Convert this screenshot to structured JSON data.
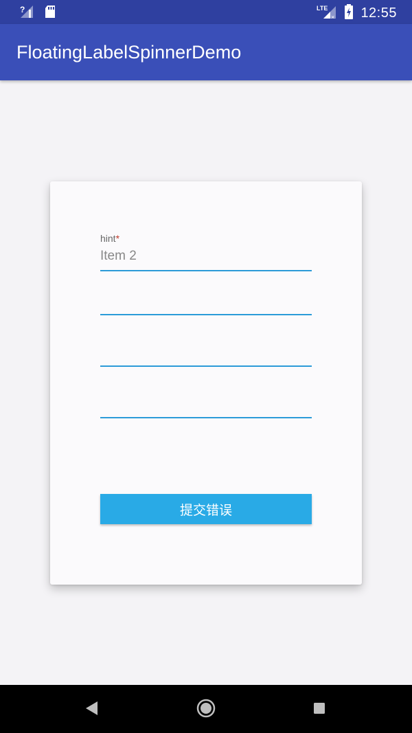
{
  "status_bar": {
    "time": "12:55",
    "icons": [
      "signal-unknown-icon",
      "sd-card-icon",
      "lte-signal-icon",
      "battery-charging-icon"
    ],
    "lte_label": "LTE",
    "background": "#2f40a0"
  },
  "app_bar": {
    "title": "FloatingLabelSpinnerDemo",
    "background": "#3a4fb8"
  },
  "form": {
    "spinner1": {
      "hint": "hint",
      "required_mark": "*",
      "value": "Item 2"
    },
    "submit_label": "提交错误",
    "accent_color": "#2b9bd8",
    "button_color": "#29aae6"
  },
  "nav_bar": {
    "icons": [
      "back-icon",
      "home-icon",
      "recents-icon"
    ]
  }
}
